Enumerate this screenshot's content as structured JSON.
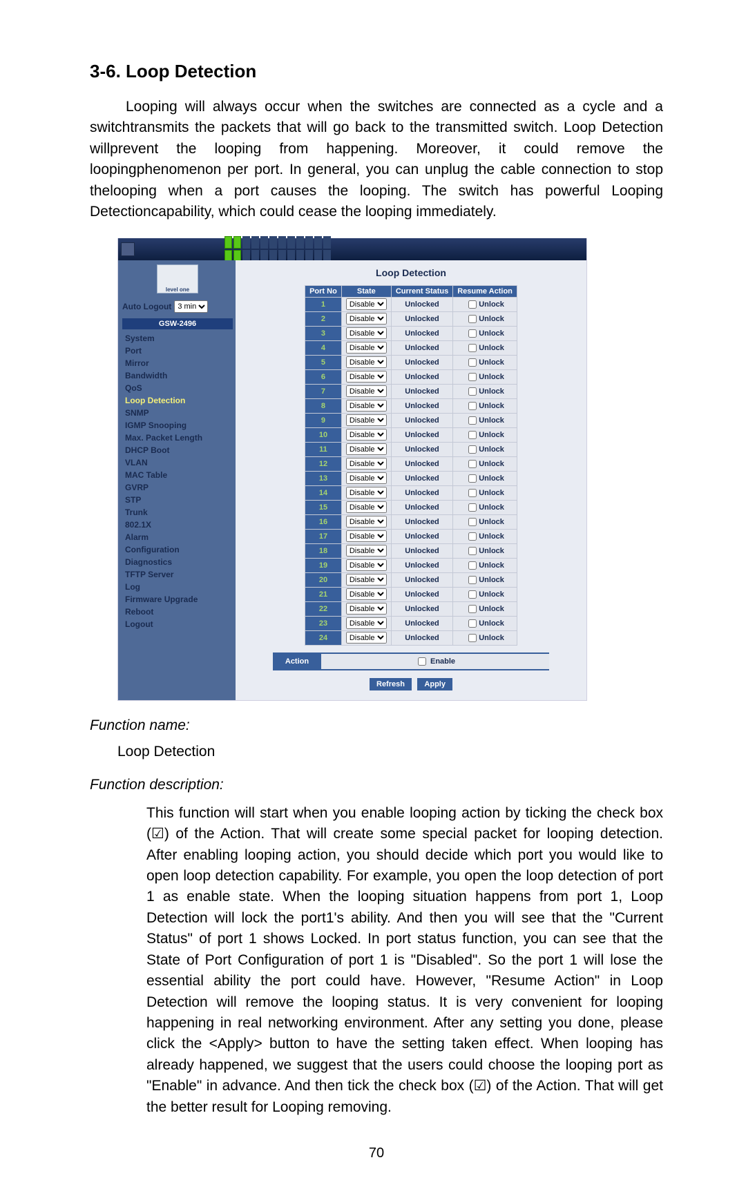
{
  "heading": "3-6. Loop Detection",
  "intro": "Looping will always occur when the switches are connected as a cycle and a switchtransmits the packets that will go back to the transmitted switch. Loop Detection willprevent the looping from happening. Moreover, it could remove the loopingphenomenon per port. In general, you can unplug the cable connection to stop thelooping when a port causes the looping. The switch has powerful Looping Detectioncapability, which could cease the looping immediately.",
  "function_name_label": "Function name:",
  "function_name": "Loop Detection",
  "function_description_label": "Function description:",
  "function_description": "This function will start when you enable looping action by ticking the check box (☑) of the Action. That will create some special packet for looping detection. After enabling looping action, you should decide which port you would like to open loop detection capability. For example, you open the loop detection of port 1 as enable state. When the looping situation happens from port 1, Loop Detection will lock the port1's ability. And then you will see that the \"Current Status\" of port 1 shows Locked. In port status function, you can see that the State of Port Configuration of port 1 is \"Disabled\". So the port 1 will lose the essential ability the port could have. However, \"Resume Action\" in Loop Detection will remove the looping status. It is very convenient for looping happening in real networking environment. After any setting you done, please click the <Apply> button to have the setting taken effect. When looping has already happened, we suggest that the users could choose the looping port as \"Enable\" in advance. And then tick the check box (☑) of the Action. That will get the better result for Looping removing.",
  "page_number": "70",
  "figure": {
    "logo_text": "level one",
    "auto_logout_label": "Auto Logout",
    "auto_logout_value": "3 min",
    "device_model": "GSW-2496",
    "nav": [
      {
        "label": "System",
        "active": false
      },
      {
        "label": "Port",
        "active": false
      },
      {
        "label": "Mirror",
        "active": false
      },
      {
        "label": "Bandwidth",
        "active": false
      },
      {
        "label": "QoS",
        "active": false
      },
      {
        "label": "Loop Detection",
        "active": true
      },
      {
        "label": "SNMP",
        "active": false
      },
      {
        "label": "IGMP Snooping",
        "active": false
      },
      {
        "label": "Max. Packet Length",
        "active": false
      },
      {
        "label": "DHCP Boot",
        "active": false
      },
      {
        "label": "VLAN",
        "active": false
      },
      {
        "label": "MAC Table",
        "active": false
      },
      {
        "label": "GVRP",
        "active": false
      },
      {
        "label": "STP",
        "active": false
      },
      {
        "label": "Trunk",
        "active": false
      },
      {
        "label": "802.1X",
        "active": false
      },
      {
        "label": "Alarm",
        "active": false
      },
      {
        "label": "Configuration",
        "active": false
      },
      {
        "label": "Diagnostics",
        "active": false
      },
      {
        "label": "TFTP Server",
        "active": false
      },
      {
        "label": "Log",
        "active": false
      },
      {
        "label": "Firmware Upgrade",
        "active": false
      },
      {
        "label": "Reboot",
        "active": false
      },
      {
        "label": "Logout",
        "active": false
      }
    ],
    "main_title": "Loop Detection",
    "headers": {
      "port": "Port No",
      "state": "State",
      "status": "Current Status",
      "resume": "Resume Action"
    },
    "state_option": "Disable",
    "status_value": "Unlocked",
    "resume_label": "Unlock",
    "port_count": 24,
    "action_label": "Action",
    "enable_label": "Enable",
    "refresh_btn": "Refresh",
    "apply_btn": "Apply"
  }
}
